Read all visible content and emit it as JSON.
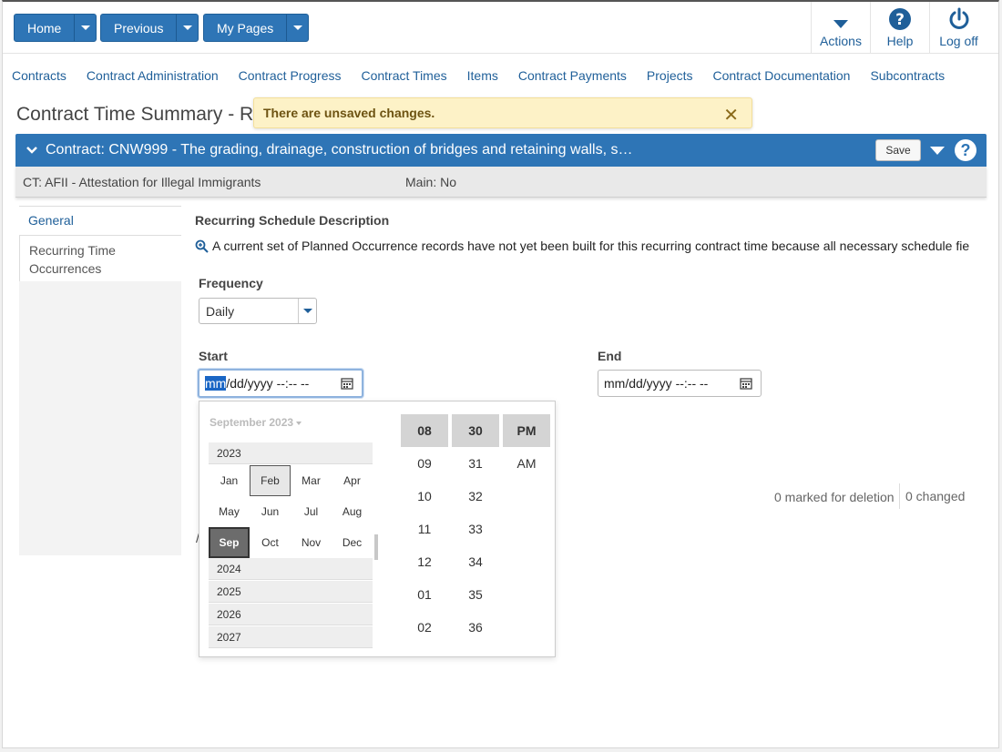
{
  "nav": {
    "home": "Home",
    "previous": "Previous",
    "my_pages": "My Pages",
    "actions": "Actions",
    "help": "Help",
    "logoff": "Log off"
  },
  "menu": [
    "Contracts",
    "Contract Administration",
    "Contract Progress",
    "Contract Times",
    "Items",
    "Contract Payments",
    "Projects",
    "Contract Documentation",
    "Subcontracts"
  ],
  "page_title": "Contract Time Summary - R",
  "toast": {
    "message": "There are unsaved changes.",
    "close": "✕"
  },
  "contract": {
    "title": "Contract: CNW999 - The grading, drainage, construction of bridges and retaining walls, s…",
    "save": "Save",
    "help": "?",
    "ct": "CT: AFII - Attestation for Illegal Immigrants",
    "main": "Main: No"
  },
  "tabs": {
    "general": "General",
    "recurring": "Recurring Time Occurrences"
  },
  "content": {
    "section_title": "Recurring Schedule Description",
    "info": "A current set of Planned Occurrence records have not yet been built for this recurring contract time because all necessary schedule fie",
    "frequency_label": "Frequency",
    "frequency_value": "Daily",
    "start_label": "Start",
    "start_seg_mm": "mm",
    "start_rest": "/dd/yyyy --:-- --",
    "end_label": "End",
    "end_value": "mm/dd/yyyy --:-- --",
    "marked": "0 marked for deletion",
    "changed": "0 changed",
    "slash": "/"
  },
  "picker": {
    "month_header": "September 2023",
    "years": [
      "2023",
      "2024",
      "2025",
      "2026",
      "2027"
    ],
    "months": [
      "Jan",
      "Feb",
      "Mar",
      "Apr",
      "May",
      "Jun",
      "Jul",
      "Aug",
      "Sep",
      "Oct",
      "Nov",
      "Dec"
    ],
    "hover_month": "Feb",
    "selected_month": "Sep",
    "hours": [
      "08",
      "09",
      "10",
      "11",
      "12",
      "01",
      "02"
    ],
    "minutes": [
      "30",
      "31",
      "32",
      "33",
      "34",
      "35",
      "36"
    ],
    "ampm": [
      "PM",
      "AM"
    ]
  },
  "colors": {
    "brand": "#2e75b6",
    "link": "#1f5f99",
    "toast_bg": "#fdf2c7"
  }
}
